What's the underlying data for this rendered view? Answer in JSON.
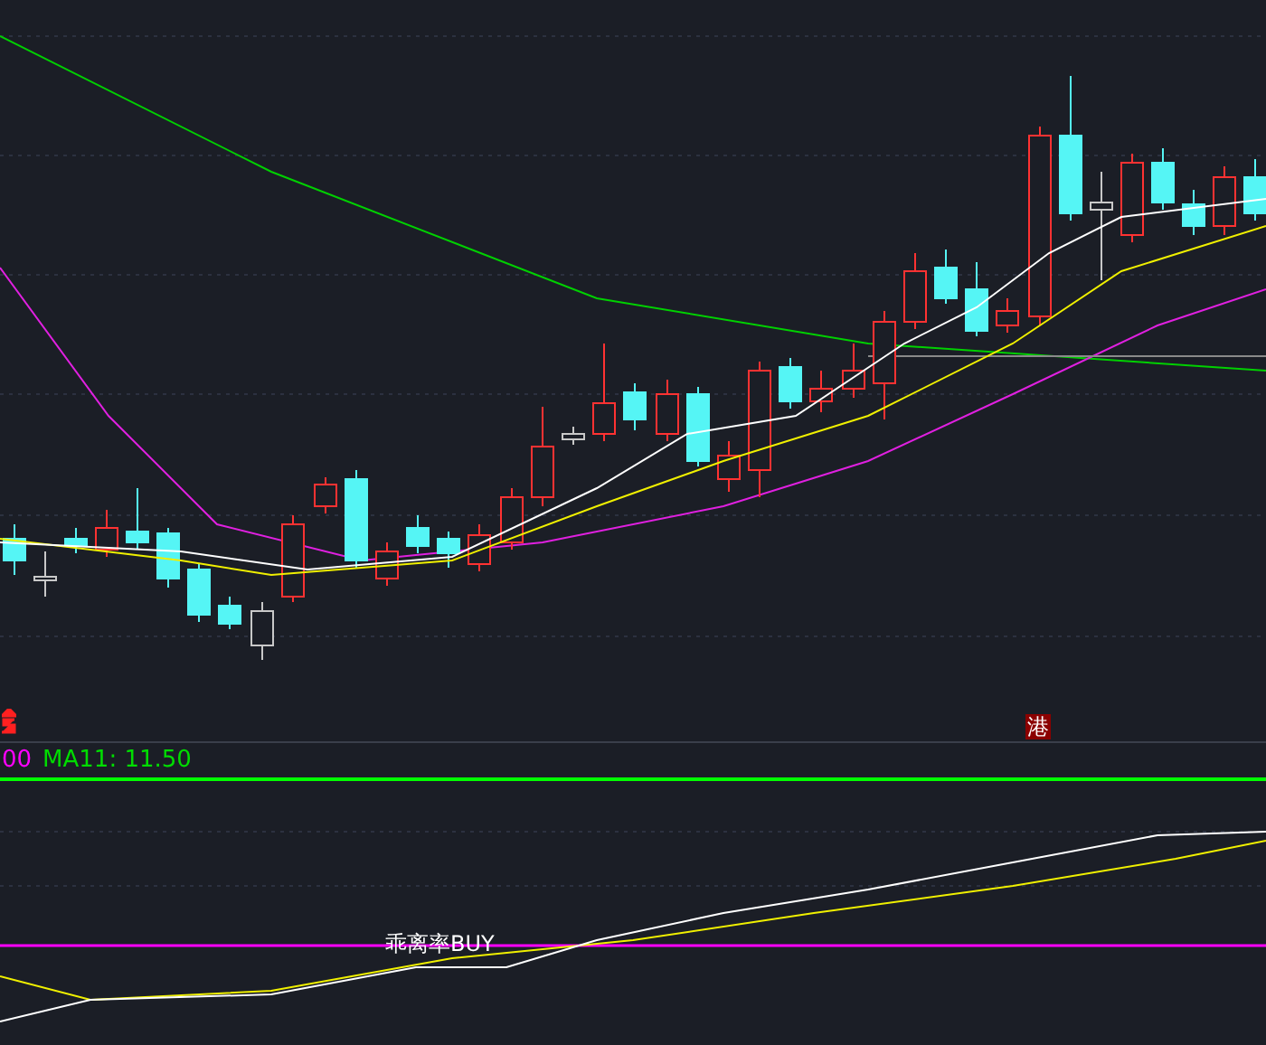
{
  "price_panel": {
    "event_badge": "港"
  },
  "legend": [
    {
      "text": "00",
      "color": "#ff00ff"
    },
    {
      "text": "MA11: 11.50",
      "color": "#00dd00"
    }
  ],
  "indicator_panel": {
    "label": "乖离率BUY"
  }
}
